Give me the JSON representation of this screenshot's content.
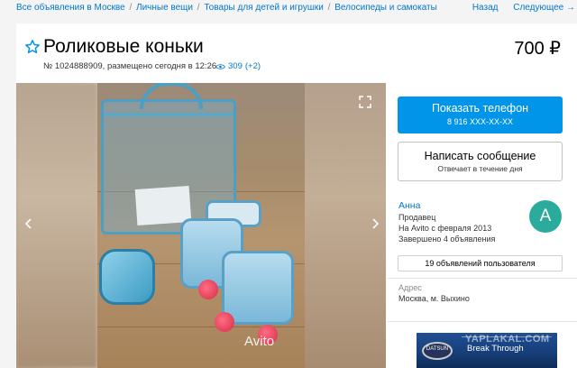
{
  "breadcrumbs": [
    "Все объявления в Москве",
    "Личные вещи",
    "Товары для детей и игрушки",
    "Велосипеды и самокаты"
  ],
  "breadcrumb_sep": "/",
  "nav": {
    "back": "Назад",
    "next": "Следующее →"
  },
  "listing": {
    "title": "Роликовые коньки",
    "price": "700 ₽",
    "meta": "№ 1024888909, размещено сегодня в 12:26",
    "views": "309",
    "views_delta": "(+2)"
  },
  "gallery": {
    "watermark": "Avito"
  },
  "contact": {
    "phone_button": "Показать телефон",
    "phone_masked": "8 916 XXX-XX-XX",
    "message_button": "Написать сообщение",
    "message_sub": "Отвечает в течение дня"
  },
  "seller": {
    "name": "Анна",
    "role": "Продавец",
    "since": "На Avito с февраля 2013",
    "completed": "Завершено 4 объявления",
    "avatar_letter": "A",
    "avatar_color": "#2bab9b",
    "ads_button": "19 объявлений пользователя"
  },
  "address": {
    "label": "Адрес",
    "value": "Москва, м. Выхино"
  },
  "banner": {
    "tagline": "Break Through",
    "logo": "DATSUN",
    "watermark": "YAPLAKAL.COM"
  },
  "colors": {
    "link": "#0077cc",
    "primary": "#0095e9",
    "page_bg": "#f4f4f4"
  },
  "icons": {
    "favorite": "star-outline-icon",
    "views": "eye-icon",
    "expand": "expand-icon",
    "prev": "chevron-left-icon",
    "next": "chevron-right-icon"
  }
}
